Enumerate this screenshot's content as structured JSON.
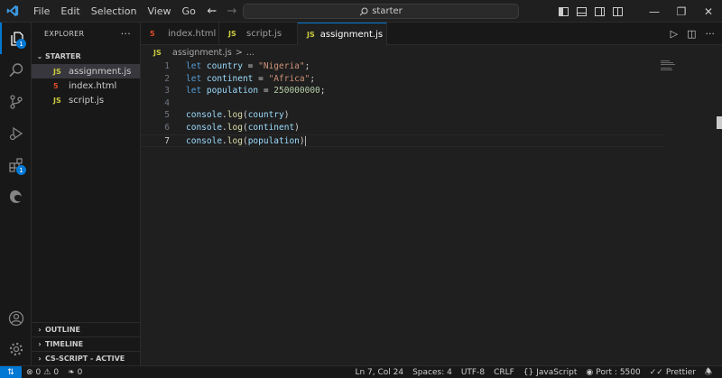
{
  "menu": [
    "File",
    "Edit",
    "Selection",
    "View",
    "Go",
    "···"
  ],
  "command_center": {
    "text": "starter"
  },
  "activity_bar": {
    "explorer_badge": "1",
    "extensions_badge": "1"
  },
  "sidebar": {
    "title": "EXPLORER",
    "folder": "STARTER",
    "files": [
      {
        "name": "assignment.js",
        "icon": "JS"
      },
      {
        "name": "index.html",
        "icon": "5"
      },
      {
        "name": "script.js",
        "icon": "JS"
      }
    ],
    "bottom_sections": [
      "OUTLINE",
      "TIMELINE",
      "CS-SCRIPT - ACTIVE"
    ]
  },
  "tabs": [
    {
      "name": "index.html",
      "icon": "5"
    },
    {
      "name": "script.js",
      "icon": "JS"
    },
    {
      "name": "assignment.js",
      "icon": "JS"
    }
  ],
  "breadcrumb": {
    "icon": "JS",
    "file": "assignment.js",
    "sep": ">",
    "more": "..."
  },
  "editor": {
    "line_numbers": [
      "1",
      "2",
      "3",
      "4",
      "5",
      "6",
      "7"
    ],
    "lines": [
      [
        [
          "kw",
          "let"
        ],
        [
          "op",
          " "
        ],
        [
          "var",
          "country"
        ],
        [
          "op",
          " = "
        ],
        [
          "str",
          "\"Nigeria\""
        ],
        [
          "op",
          ";"
        ]
      ],
      [
        [
          "kw",
          "let"
        ],
        [
          "op",
          " "
        ],
        [
          "var",
          "continent"
        ],
        [
          "op",
          " = "
        ],
        [
          "str",
          "\"Africa\""
        ],
        [
          "op",
          ";"
        ]
      ],
      [
        [
          "kw",
          "let"
        ],
        [
          "op",
          " "
        ],
        [
          "var",
          "population"
        ],
        [
          "op",
          " = "
        ],
        [
          "num",
          "250000000"
        ],
        [
          "op",
          ";"
        ]
      ],
      [],
      [
        [
          "var",
          "console"
        ],
        [
          "op",
          "."
        ],
        [
          "fn",
          "log"
        ],
        [
          "op",
          "("
        ],
        [
          "var",
          "country"
        ],
        [
          "op",
          ")"
        ]
      ],
      [
        [
          "var",
          "console"
        ],
        [
          "op",
          "."
        ],
        [
          "fn",
          "log"
        ],
        [
          "op",
          "("
        ],
        [
          "var",
          "continent"
        ],
        [
          "op",
          ")"
        ]
      ],
      [
        [
          "var",
          "console"
        ],
        [
          "op",
          "."
        ],
        [
          "fn",
          "log"
        ],
        [
          "op",
          "("
        ],
        [
          "var",
          "population"
        ],
        [
          "op",
          ")"
        ]
      ]
    ]
  },
  "status": {
    "errors": "0",
    "warnings": "0",
    "ports": "0",
    "position": "Ln 7, Col 24",
    "spaces": "Spaces: 4",
    "encoding": "UTF-8",
    "eol": "CRLF",
    "language": "JavaScript",
    "port": "Port : 5500",
    "prettier": "Prettier"
  },
  "colors": {
    "accent": "#0078d4",
    "keyword": "#569cd6",
    "variable": "#9cdcfe",
    "string": "#ce9178",
    "number": "#b5cea8",
    "function": "#dcdcaa"
  }
}
